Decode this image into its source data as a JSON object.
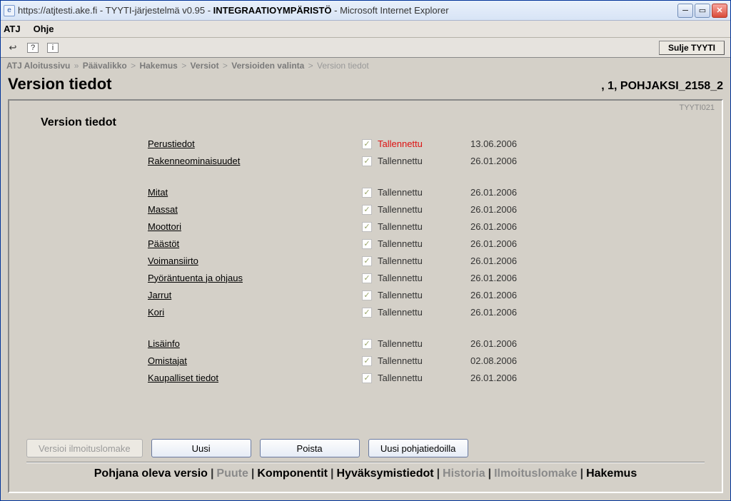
{
  "window": {
    "url": "https://atjtesti.ake.fi",
    "app": "TYYTI-järjestelmä v0.95",
    "env": "INTEGRAATIOYMPÄRISTÖ",
    "browser": "Microsoft Internet Explorer"
  },
  "menu": {
    "atj": "ATJ",
    "ohje": "Ohje"
  },
  "toolbar": {
    "close_label": "Sulje TYYTI"
  },
  "breadcrumb": {
    "items": [
      "ATJ Aloitussivu",
      "Päävalikko",
      "Hakemus",
      "Versiot",
      "Versioiden valinta"
    ],
    "current": "Version tiedot",
    "sep_first": "»",
    "sep": ">"
  },
  "header": {
    "title": "Version tiedot",
    "right": ", 1, POHJAKSI_2158_2"
  },
  "panel": {
    "id": "TYYTI021",
    "section_title": "Version tiedot"
  },
  "rows": [
    {
      "label": "Perustiedot",
      "status": "Tallennettu",
      "date": "13.06.2006",
      "highlight": true
    },
    {
      "label": "Rakenneominaisuudet",
      "status": "Tallennettu",
      "date": "26.01.2006"
    },
    {
      "gap": true
    },
    {
      "label": "Mitat",
      "status": "Tallennettu",
      "date": "26.01.2006"
    },
    {
      "label": "Massat",
      "status": "Tallennettu",
      "date": "26.01.2006"
    },
    {
      "label": "Moottori",
      "status": "Tallennettu",
      "date": "26.01.2006"
    },
    {
      "label": "Päästöt",
      "status": "Tallennettu",
      "date": "26.01.2006"
    },
    {
      "label": "Voimansiirto",
      "status": "Tallennettu",
      "date": "26.01.2006"
    },
    {
      "label": "Pyöräntuenta ja ohjaus",
      "status": "Tallennettu",
      "date": "26.01.2006"
    },
    {
      "label": "Jarrut",
      "status": "Tallennettu",
      "date": "26.01.2006"
    },
    {
      "label": "Kori",
      "status": "Tallennettu",
      "date": "26.01.2006"
    },
    {
      "gap": true
    },
    {
      "label": "Lisäinfo",
      "status": "Tallennettu",
      "date": "26.01.2006"
    },
    {
      "label": "Omistajat",
      "status": "Tallennettu",
      "date": "02.08.2006"
    },
    {
      "label": "Kaupalliset tiedot",
      "status": "Tallennettu",
      "date": "26.01.2006"
    }
  ],
  "buttons": {
    "versioi": "Versioi ilmoituslomake",
    "uusi": "Uusi",
    "poista": "Poista",
    "uusi_pohja": "Uusi pohjatiedoilla"
  },
  "footer": {
    "items": [
      {
        "label": "Pohjana oleva versio",
        "muted": false
      },
      {
        "label": "Puute",
        "muted": true
      },
      {
        "label": "Komponentit",
        "muted": false
      },
      {
        "label": "Hyväksymistiedot",
        "muted": false
      },
      {
        "label": "Historia",
        "muted": true
      },
      {
        "label": "Ilmoituslomake",
        "muted": true
      },
      {
        "label": "Hakemus",
        "muted": false
      }
    ]
  }
}
